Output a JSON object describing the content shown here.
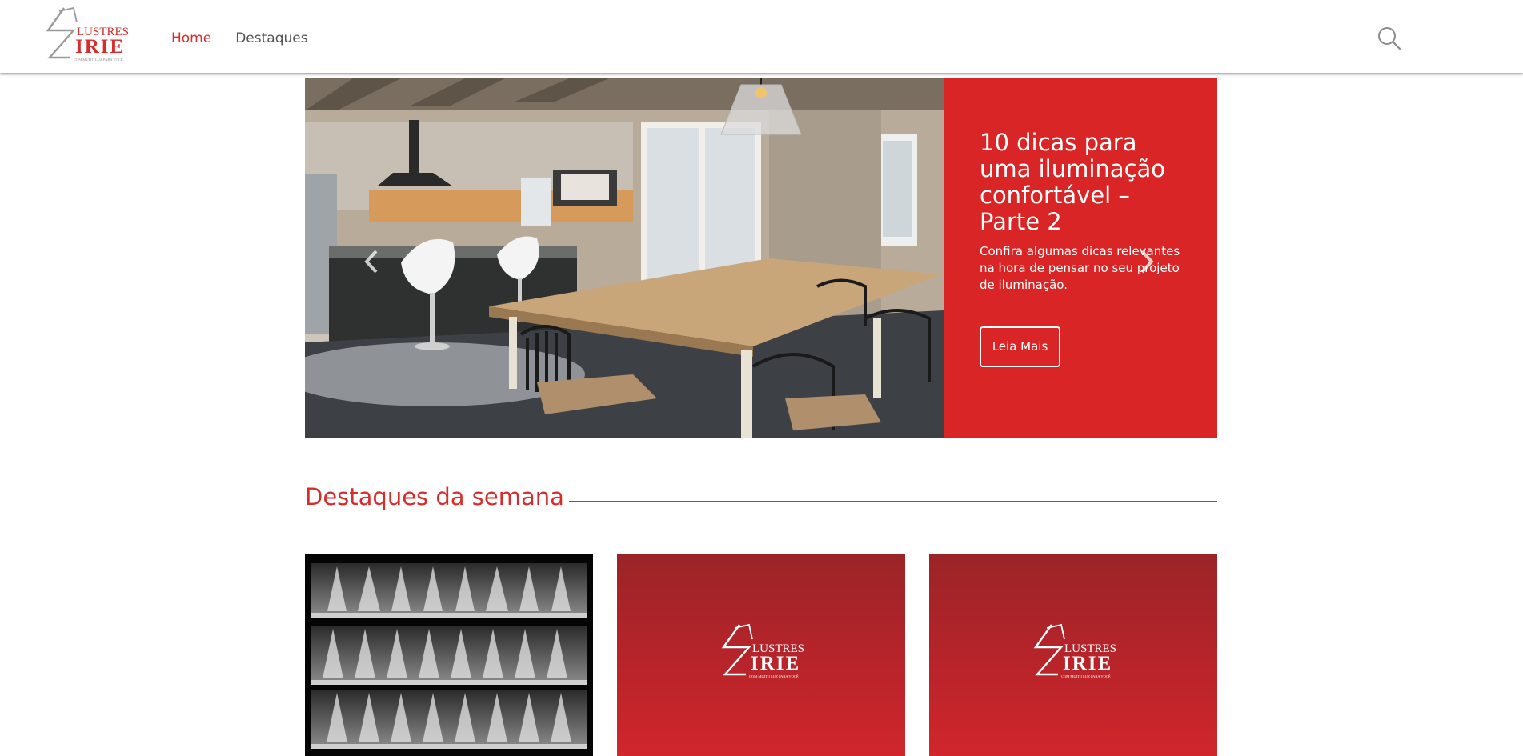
{
  "header": {
    "logo": {
      "line1": "LUSTRES",
      "line2": "IRIE",
      "tagline": "COM MUITO LUZ PARA VOCÊ"
    },
    "nav": {
      "home": "Home",
      "destaques": "Destaques"
    },
    "search_icon": "search-icon"
  },
  "hero": {
    "title": "10 dicas para uma iluminação confortável – Parte 2",
    "text": "Confira algumas dicas relevantes na hora de pensar no seu projeto de iluminação.",
    "button": "Leia Mais",
    "prev_icon": "chevron-left-icon",
    "next_icon": "chevron-right-icon"
  },
  "section": {
    "title": "Destaques da semana"
  },
  "cards": [
    {
      "type": "image"
    },
    {
      "type": "logo"
    },
    {
      "type": "logo"
    }
  ],
  "colors": {
    "accent": "#d62c2c",
    "panel": "#d92525",
    "nav_text": "#555555"
  }
}
